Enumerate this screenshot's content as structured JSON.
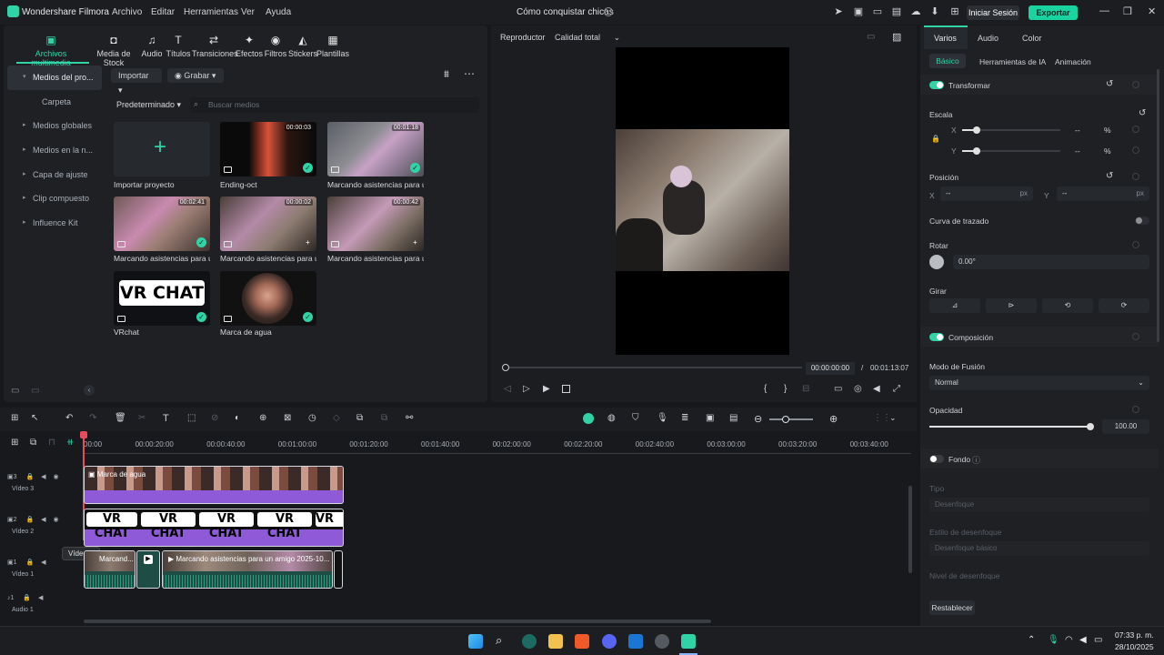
{
  "app": {
    "name": "Wondershare Filmora",
    "menus": [
      "Archivo",
      "Editar",
      "Herramientas",
      "Ver",
      "Ayuda"
    ],
    "project_title": "Cómo conquistar chicas",
    "login": "Iniciar Sesión",
    "export": "Exportar"
  },
  "toolbar": {
    "tabs": [
      "Archivos multimedia",
      "Media de Stock",
      "Audio",
      "Títulos",
      "Transiciones",
      "Efectos",
      "Filtros",
      "Stickers",
      "Plantillas"
    ]
  },
  "sidebar": {
    "items": [
      "Medios del pro...",
      "Carpeta",
      "Medios globales",
      "Medios en la n...",
      "Capa de ajuste",
      "Clip compuesto",
      "Influence Kit"
    ]
  },
  "media": {
    "import": "Importar",
    "record": "Grabar",
    "sort": "Predeterminado",
    "search_placeholder": "Buscar medios",
    "items": [
      {
        "name": "Importar proyecto",
        "duration": ""
      },
      {
        "name": "Ending-oct",
        "duration": "00:00:03"
      },
      {
        "name": "Marcando asistencias para u...",
        "duration": "00:01:18"
      },
      {
        "name": "Marcando asistencias para u...",
        "duration": "00:02:41"
      },
      {
        "name": "Marcando asistencias para u...",
        "duration": "00:00:02"
      },
      {
        "name": "Marcando asistencias para u...",
        "duration": "00:00:42"
      },
      {
        "name": "VRchat",
        "duration": ""
      },
      {
        "name": "Marca de agua",
        "duration": ""
      }
    ],
    "vrchat_text": "VR CHAT"
  },
  "preview": {
    "label": "Reproductor",
    "quality": "Calidad total",
    "time_current": "00:00:00:00",
    "time_sep": "/",
    "time_total": "00:01:13:07"
  },
  "inspector": {
    "tabs": [
      "Varios",
      "Audio",
      "Color"
    ],
    "subtabs": [
      "Básico",
      "Herramientas de IA",
      "Animación"
    ],
    "transform": "Transformar",
    "scale": "Escala",
    "x": "X",
    "y": "Y",
    "dash": "--",
    "percent": "%",
    "position": "Posición",
    "px": "px",
    "path_curve": "Curva de trazado",
    "rotate": "Rotar",
    "rotate_value": "0.00°",
    "flip": "Girar",
    "composition": "Composición",
    "blend_mode": "Modo de Fusión",
    "blend_value": "Normal",
    "opacity": "Opacidad",
    "opacity_value": "100.00",
    "background": "Fondo",
    "type": "Tipo",
    "type_value": "Desenfoque",
    "blur_style": "Estilo de desenfoque",
    "blur_style_value": "Desenfoque básico",
    "blur_level": "Nivel de desenfoque",
    "reset": "Restablecer"
  },
  "timeline": {
    "ticks": [
      "00:00",
      "00:00:20:00",
      "00:00:40:00",
      "00:01:00:00",
      "00:01:20:00",
      "00:01:40:00",
      "00:02:00:00",
      "00:02:20:00",
      "00:02:40:00",
      "00:03:00:00",
      "00:03:20:00",
      "00:03:40:00"
    ],
    "tracks": [
      {
        "num": "3",
        "name": "Vídeo 3"
      },
      {
        "num": "2",
        "name": "Vídeo 2"
      },
      {
        "num": "1",
        "name": "Vídeo 1"
      },
      {
        "num": "1",
        "name": "Audio 1"
      }
    ],
    "clip3": "Marca de agua",
    "clip1a": "Marcand...",
    "clip1b": "Marcando asistencias para un amigo 2025-10...",
    "tooltip": "Vídeo 2"
  },
  "taskbar": {
    "time": "07:33 p. m.",
    "date": "28/10/2025"
  }
}
